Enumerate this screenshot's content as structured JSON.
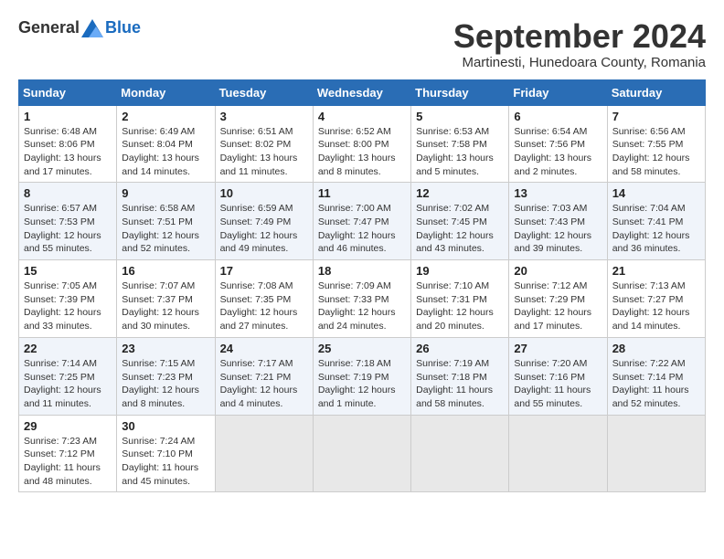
{
  "header": {
    "logo_general": "General",
    "logo_blue": "Blue",
    "month_title": "September 2024",
    "location": "Martinesti, Hunedoara County, Romania"
  },
  "calendar": {
    "columns": [
      "Sunday",
      "Monday",
      "Tuesday",
      "Wednesday",
      "Thursday",
      "Friday",
      "Saturday"
    ],
    "weeks": [
      [
        {
          "day": "1",
          "sunrise": "6:48 AM",
          "sunset": "8:06 PM",
          "daylight": "13 hours and 17 minutes."
        },
        {
          "day": "2",
          "sunrise": "6:49 AM",
          "sunset": "8:04 PM",
          "daylight": "13 hours and 14 minutes."
        },
        {
          "day": "3",
          "sunrise": "6:51 AM",
          "sunset": "8:02 PM",
          "daylight": "13 hours and 11 minutes."
        },
        {
          "day": "4",
          "sunrise": "6:52 AM",
          "sunset": "8:00 PM",
          "daylight": "13 hours and 8 minutes."
        },
        {
          "day": "5",
          "sunrise": "6:53 AM",
          "sunset": "7:58 PM",
          "daylight": "13 hours and 5 minutes."
        },
        {
          "day": "6",
          "sunrise": "6:54 AM",
          "sunset": "7:56 PM",
          "daylight": "13 hours and 2 minutes."
        },
        {
          "day": "7",
          "sunrise": "6:56 AM",
          "sunset": "7:55 PM",
          "daylight": "12 hours and 58 minutes."
        }
      ],
      [
        {
          "day": "8",
          "sunrise": "6:57 AM",
          "sunset": "7:53 PM",
          "daylight": "12 hours and 55 minutes."
        },
        {
          "day": "9",
          "sunrise": "6:58 AM",
          "sunset": "7:51 PM",
          "daylight": "12 hours and 52 minutes."
        },
        {
          "day": "10",
          "sunrise": "6:59 AM",
          "sunset": "7:49 PM",
          "daylight": "12 hours and 49 minutes."
        },
        {
          "day": "11",
          "sunrise": "7:00 AM",
          "sunset": "7:47 PM",
          "daylight": "12 hours and 46 minutes."
        },
        {
          "day": "12",
          "sunrise": "7:02 AM",
          "sunset": "7:45 PM",
          "daylight": "12 hours and 43 minutes."
        },
        {
          "day": "13",
          "sunrise": "7:03 AM",
          "sunset": "7:43 PM",
          "daylight": "12 hours and 39 minutes."
        },
        {
          "day": "14",
          "sunrise": "7:04 AM",
          "sunset": "7:41 PM",
          "daylight": "12 hours and 36 minutes."
        }
      ],
      [
        {
          "day": "15",
          "sunrise": "7:05 AM",
          "sunset": "7:39 PM",
          "daylight": "12 hours and 33 minutes."
        },
        {
          "day": "16",
          "sunrise": "7:07 AM",
          "sunset": "7:37 PM",
          "daylight": "12 hours and 30 minutes."
        },
        {
          "day": "17",
          "sunrise": "7:08 AM",
          "sunset": "7:35 PM",
          "daylight": "12 hours and 27 minutes."
        },
        {
          "day": "18",
          "sunrise": "7:09 AM",
          "sunset": "7:33 PM",
          "daylight": "12 hours and 24 minutes."
        },
        {
          "day": "19",
          "sunrise": "7:10 AM",
          "sunset": "7:31 PM",
          "daylight": "12 hours and 20 minutes."
        },
        {
          "day": "20",
          "sunrise": "7:12 AM",
          "sunset": "7:29 PM",
          "daylight": "12 hours and 17 minutes."
        },
        {
          "day": "21",
          "sunrise": "7:13 AM",
          "sunset": "7:27 PM",
          "daylight": "12 hours and 14 minutes."
        }
      ],
      [
        {
          "day": "22",
          "sunrise": "7:14 AM",
          "sunset": "7:25 PM",
          "daylight": "12 hours and 11 minutes."
        },
        {
          "day": "23",
          "sunrise": "7:15 AM",
          "sunset": "7:23 PM",
          "daylight": "12 hours and 8 minutes."
        },
        {
          "day": "24",
          "sunrise": "7:17 AM",
          "sunset": "7:21 PM",
          "daylight": "12 hours and 4 minutes."
        },
        {
          "day": "25",
          "sunrise": "7:18 AM",
          "sunset": "7:19 PM",
          "daylight": "12 hours and 1 minute."
        },
        {
          "day": "26",
          "sunrise": "7:19 AM",
          "sunset": "7:18 PM",
          "daylight": "11 hours and 58 minutes."
        },
        {
          "day": "27",
          "sunrise": "7:20 AM",
          "sunset": "7:16 PM",
          "daylight": "11 hours and 55 minutes."
        },
        {
          "day": "28",
          "sunrise": "7:22 AM",
          "sunset": "7:14 PM",
          "daylight": "11 hours and 52 minutes."
        }
      ],
      [
        {
          "day": "29",
          "sunrise": "7:23 AM",
          "sunset": "7:12 PM",
          "daylight": "11 hours and 48 minutes."
        },
        {
          "day": "30",
          "sunrise": "7:24 AM",
          "sunset": "7:10 PM",
          "daylight": "11 hours and 45 minutes."
        },
        null,
        null,
        null,
        null,
        null
      ]
    ]
  }
}
